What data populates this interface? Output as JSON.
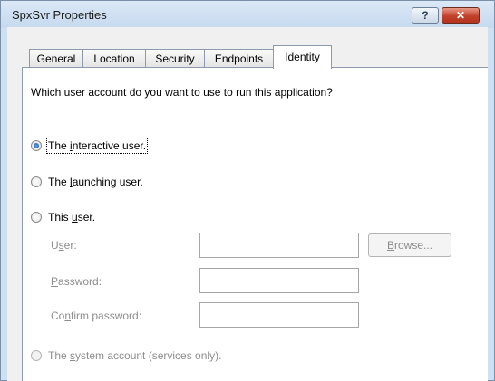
{
  "window": {
    "title": "SpxSvr Properties",
    "help_label": "?",
    "close_label": "✕"
  },
  "tabs": [
    {
      "label": "General"
    },
    {
      "label": "Location"
    },
    {
      "label": "Security"
    },
    {
      "label": "Endpoints"
    },
    {
      "label": "Identity",
      "active": true
    }
  ],
  "identity": {
    "question": "Which user account do you want to use to run this application?",
    "options": [
      {
        "pre": "The ",
        "key": "i",
        "post": "nteractive user.",
        "checked": true,
        "enabled": true
      },
      {
        "pre": "The ",
        "key": "l",
        "post": "aunching user.",
        "checked": false,
        "enabled": true
      },
      {
        "pre": "This ",
        "key": "u",
        "post": "ser.",
        "checked": false,
        "enabled": true
      },
      {
        "pre": "The ",
        "key": "s",
        "post": "ystem account (services only).",
        "checked": false,
        "enabled": false
      }
    ],
    "fields": {
      "user": {
        "pre": "U",
        "key": "s",
        "post": "er:",
        "value": ""
      },
      "password": {
        "pre": "",
        "key": "P",
        "post": "assword:",
        "value": ""
      },
      "confirm": {
        "pre": "Co",
        "key": "n",
        "post": "firm password:",
        "value": ""
      }
    },
    "browse": {
      "key": "B",
      "post": "rowse..."
    }
  }
}
